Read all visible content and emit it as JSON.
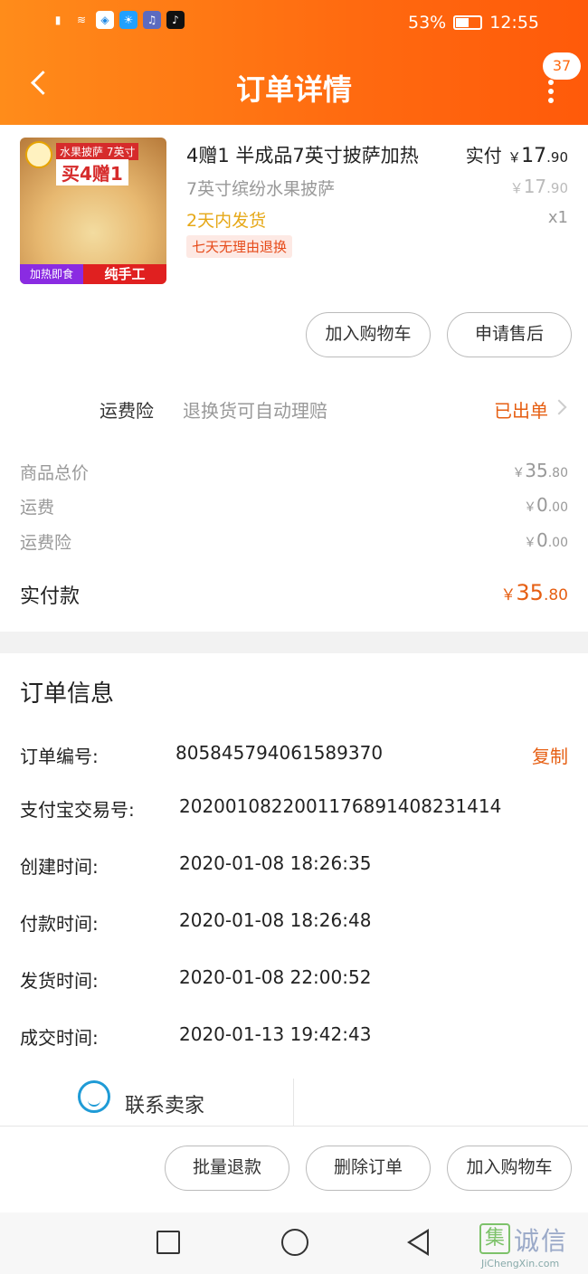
{
  "status_bar": {
    "battery": "53%",
    "time": "12:55"
  },
  "header": {
    "title": "订单详情",
    "badge_count": "37"
  },
  "product": {
    "image_tag_top": "水果披萨 7英寸",
    "image_tag_main": "买4赠1",
    "image_tag_left": "加热即食",
    "image_tag_right": "纯手工",
    "name": "4赠1 半成品7英寸披萨加热",
    "sku": "7英寸缤纷水果披萨",
    "shipping": "2天内发货",
    "return_tag": "七天无理由退换",
    "paid_label": "实付",
    "paid_yen": "￥",
    "paid_int": "17",
    "paid_dec": ".90",
    "orig_yen": "￥",
    "orig_int": "17",
    "orig_dec": ".90",
    "qty": "x1",
    "add_cart_button": "加入购物车",
    "after_sale_button": "申请售后"
  },
  "insurance": {
    "label": "运费险",
    "desc": "退换货可自动理赔",
    "status": "已出单"
  },
  "summary": {
    "rows": [
      {
        "label": "商品总价",
        "yen": "￥",
        "int": "35",
        "dec": ".80"
      },
      {
        "label": "运费",
        "yen": "￥",
        "int": "0",
        "dec": ".00"
      },
      {
        "label": "运费险",
        "yen": "￥",
        "int": "0",
        "dec": ".00"
      }
    ],
    "total_label": "实付款",
    "total_yen": "￥",
    "total_int": "35",
    "total_dec": ".80"
  },
  "order_info": {
    "title": "订单信息",
    "copy": "复制",
    "rows": [
      {
        "label": "订单编号:",
        "value": "805845794061589370"
      },
      {
        "label": "支付宝交易号:",
        "value": "2020010822001176891408231414"
      },
      {
        "label": "创建时间:",
        "value": "2020-01-08 18:26:35"
      },
      {
        "label": "付款时间:",
        "value": "2020-01-08 18:26:48"
      },
      {
        "label": "发货时间:",
        "value": "2020-01-08 22:00:52"
      },
      {
        "label": "成交时间:",
        "value": "2020-01-13 19:42:43"
      }
    ]
  },
  "contact": {
    "label": "联系卖家"
  },
  "actions": {
    "refund": "批量退款",
    "delete": "删除订单",
    "add_cart": "加入购物车"
  },
  "watermark": {
    "box": "集",
    "text": "诚信",
    "url": "JiChengXin.com"
  }
}
